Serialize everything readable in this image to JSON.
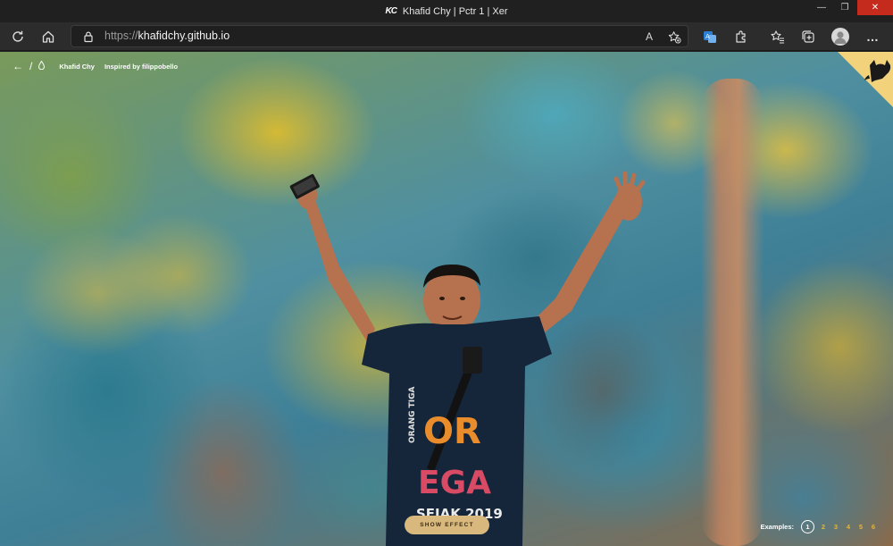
{
  "window": {
    "logo": "KC",
    "title": "Khafid Chy | Pctr 1 | Xer",
    "minimize": "—",
    "maximize": "❐",
    "close": "✕"
  },
  "toolbar": {
    "url_scheme": "https://",
    "url_host": "khafidchy.github.io",
    "read_aloud": "A",
    "more": "…",
    "icons": [
      "refresh-icon",
      "home-icon",
      "lock-icon",
      "read-aloud-icon",
      "add-favorite-icon",
      "translator-icon",
      "extensions-icon",
      "favorites-icon",
      "collections-icon",
      "profile-icon",
      "more-icon"
    ]
  },
  "site": {
    "back": "←",
    "slash": "/",
    "drop": "💧",
    "name": "Khafid Chy",
    "credit": "Inspired by filippobello",
    "shirt_line1": "OR",
    "shirt_line2": "EGA",
    "shirt_line3": "SEJAK 2019",
    "shirt_side": "ORANG TIGA",
    "show_effect": "SHOW EFFECT",
    "examples_label": "Examples:",
    "examples": [
      "1",
      "2",
      "3",
      "4",
      "5",
      "6"
    ],
    "active_example": "1"
  },
  "colors": {
    "accent": "#e3b53b",
    "button_bg": "#d8b87c",
    "corner": "#f2d27a"
  }
}
